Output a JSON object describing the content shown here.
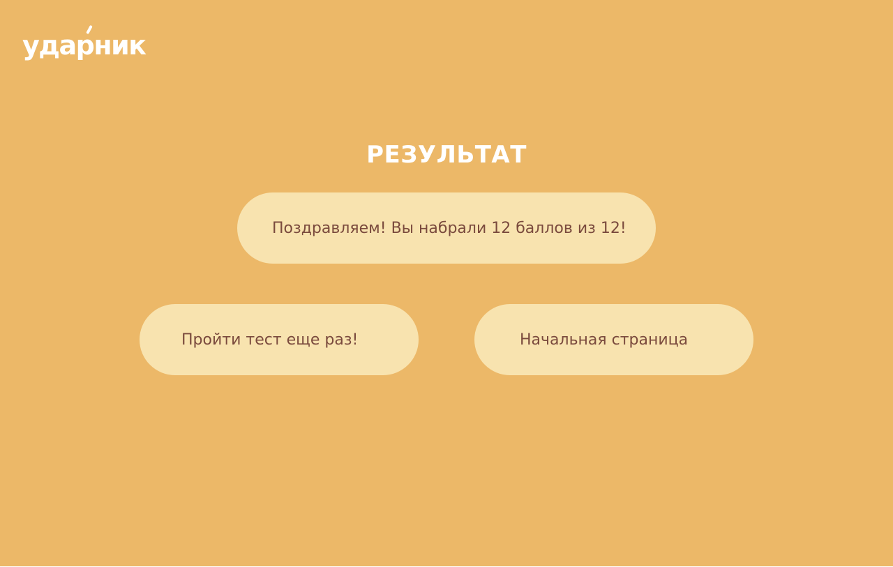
{
  "header": {
    "logo_prefix": "уда",
    "logo_accent": "р",
    "logo_suffix": "ник"
  },
  "result": {
    "title": "РЕЗУЛЬТАТ",
    "message": "Поздравляем! Вы набрали 12 баллов из 12!"
  },
  "actions": {
    "retry_label": "Пройти тест еще раз!",
    "home_label": "Начальная страница"
  },
  "colors": {
    "background": "#ECB868",
    "pill": "#F8E3AF",
    "pill_text": "#7A4A3D",
    "heading": "#FFFFFF"
  }
}
